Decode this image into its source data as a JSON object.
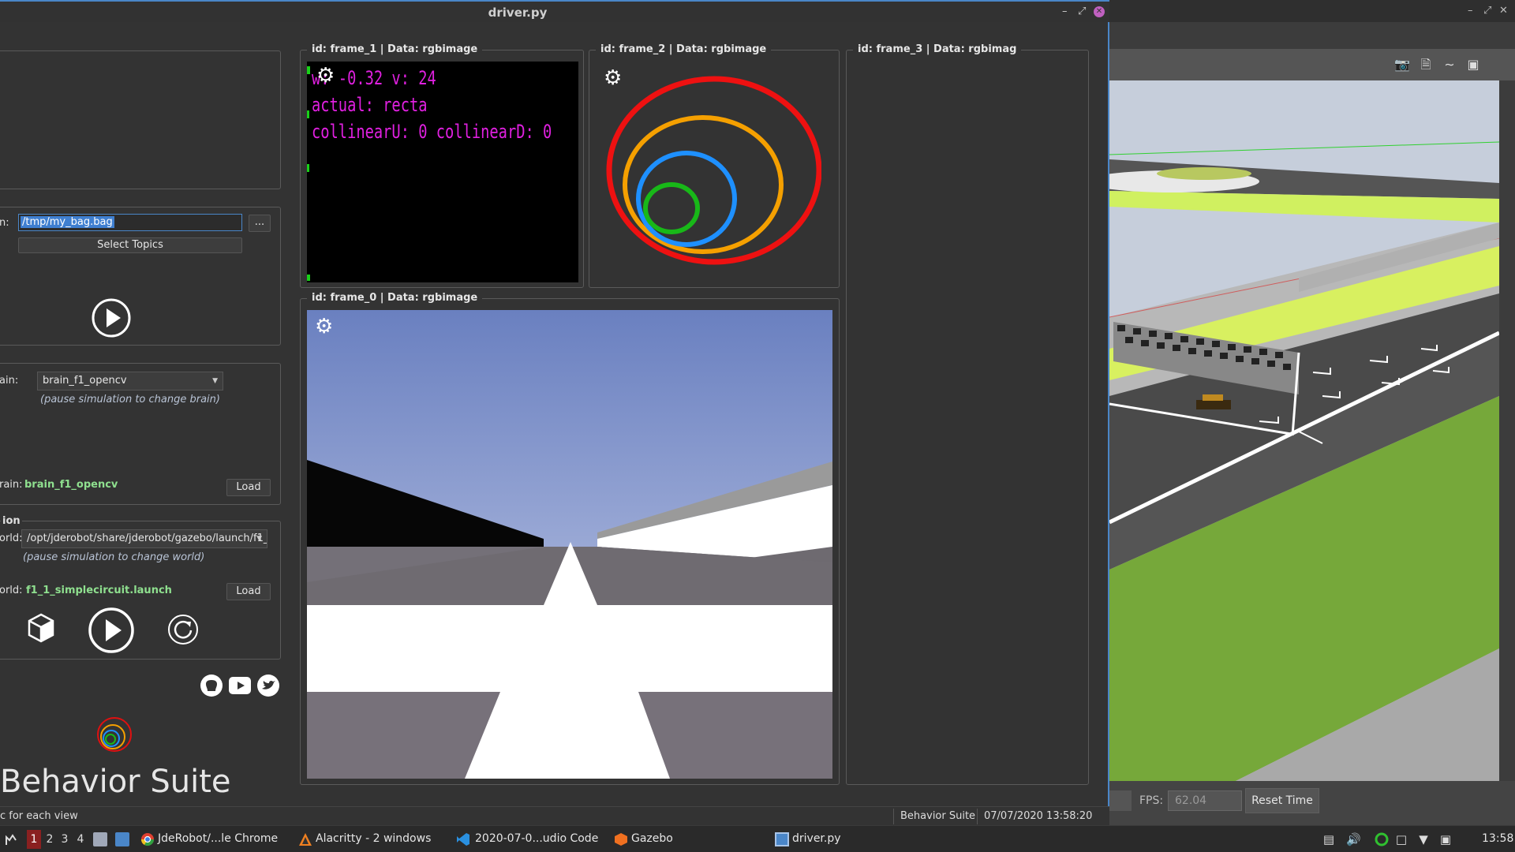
{
  "driver_window": {
    "title": "driver.py",
    "recorder": {
      "path_label_partial": "n:",
      "path_value": "/tmp/my_bag.bag",
      "browse_label": "...",
      "select_topics_label": "Select Topics"
    },
    "brain": {
      "brain_label_partial": "ain:",
      "brain_value": "brain_f1_opencv",
      "brain_note": "(pause simulation to change brain)",
      "current_label_partial": "rain:",
      "current_value": "brain_f1_opencv",
      "load_label": "Load"
    },
    "simulation": {
      "section_label_partial": "ion",
      "world_label_partial": "orld:",
      "world_value": "/opt/jderobot/share/jderobot/gazebo/launch/f1_1",
      "world_note": "(pause simulation to change world)",
      "current_label_partial": "orld:",
      "current_value": "f1_1_simplecircuit.launch",
      "load_label": "Load"
    },
    "suite_title": "Behavior Suite",
    "frames": [
      {
        "title": "id:  frame_1 | Data:  rgbimage"
      },
      {
        "title": "id:  frame_2 | Data:  rgbimage"
      },
      {
        "title": "id:  frame_3 | Data:  rgbimag"
      },
      {
        "title": "id:  frame_0 | Data:  rgbimage"
      }
    ],
    "frame_1_overlay": {
      "line1": "w: -0.32 v: 24",
      "line2": "actual: recta",
      "line3": "collinearU: 0 collinearD: 0"
    },
    "status": {
      "left_text": "c for each view",
      "app_name": "Behavior Suite",
      "datetime": "07/07/2020 13:58:20"
    }
  },
  "gazebo": {
    "fps_label": "FPS:",
    "fps_value": "62.04",
    "reset_label": "Reset Time"
  },
  "taskbar": {
    "workspaces": [
      "1",
      "2",
      "3",
      "4"
    ],
    "active_workspace": "1",
    "apps": [
      {
        "label": "JdeRobot/...le Chrome"
      },
      {
        "label": "Alacritty - 2 windows"
      },
      {
        "label": "2020-07-0...udio Code"
      },
      {
        "label": "Gazebo"
      },
      {
        "label": "driver.py"
      }
    ],
    "clock": "13:58"
  },
  "colors": {
    "accent": "#4a86c8",
    "overlay_text": "#e020e0",
    "green_label": "#8fe08f",
    "ring_red": "#ee1111",
    "ring_orange": "#f5a000",
    "ring_blue": "#1e90ff",
    "ring_green": "#18b818"
  }
}
